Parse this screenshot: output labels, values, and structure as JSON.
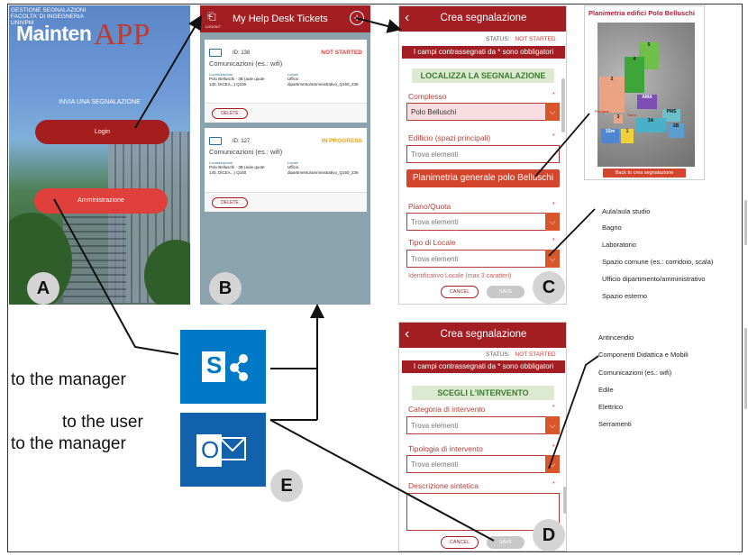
{
  "panel_a": {
    "header_lines": [
      "GESTIONE SEGNALAZIONI",
      "FACOLTA' DI INGEGNERIA",
      "UNIVPM"
    ],
    "logo_part1": "Mainten",
    "logo_part2": "APP",
    "subtitle": "INVIA UNA SEGNALAZIONE",
    "login_label": "Login",
    "admin_label": "Amministrazione",
    "badge": "A"
  },
  "panel_b": {
    "icon_caption": "LOGOUT",
    "title": "My Help Desk Tickets",
    "badge": "B",
    "tickets": [
      {
        "id": "ID: 138",
        "status": "NOT STARTED",
        "status_color": "#e0403c",
        "category": "Comunicazioni (es.: wifi)",
        "loc_label": "Localizzazione",
        "loc_value": "Polo Belluschi - 3B (aule quote 140, DICEA...) Q150",
        "locale_label": "Locale",
        "locale_value": "Ufficio dipartimento/amministrativo_Q150_239",
        "delete_label": "DELETE"
      },
      {
        "id": "ID: 127",
        "status": "IN PROGRESS",
        "status_color": "#e8a317",
        "category": "Comunicazioni (es.: wifi)",
        "loc_label": "Localizzazione",
        "loc_value": "Polo Belluschi - 3B (aule quote 140, DICEA...) Q150",
        "locale_label": "Locale",
        "locale_value": "Ufficio dipartimento/amministrativo_Q150_239",
        "delete_label": "DELETE"
      }
    ]
  },
  "panel_c": {
    "title": "Crea segnalazione",
    "status_label": "STATUS:",
    "status_value": "NOT STARTED",
    "required_note": "I campi contrassegnati da * sono obbligatori",
    "section": "LOCALIZZA LA SEGNALAZIONE",
    "field1_label": "Complesso",
    "field1_value": "Polo Belluschi",
    "field2_label": "Edificio (spazi principali)",
    "field2_value": "Trova elementi",
    "map_button": "Planimetria generale polo Belluschi",
    "field3_label": "Piano/Quota",
    "field3_value": "Trova elementi",
    "field4_label": "Tipo di Locale",
    "field4_value": "Trova elementi",
    "field5_label": "Identificativo Locale (max 3 caratteri)",
    "cancel_label": "CANCEL",
    "save_label": "SAVE",
    "star": "*",
    "badge": "C"
  },
  "map": {
    "title": "Planimetria edifici Polo Belluschi",
    "back_label": "Back to crea segnalazione",
    "labels": [
      "1",
      "2",
      "3",
      "3A",
      "3B",
      "4",
      "5",
      "PMS",
      "AMA",
      "1Sm",
      "Fontana",
      "Torre"
    ]
  },
  "list_locale": {
    "options": [
      "Aula/aula studio",
      "Bagno",
      "Laboratorio",
      "Spazio comune (es.: corridoio, scala)",
      "Ufficio dipartimento/amministrativo",
      "Spazio esterno"
    ]
  },
  "panel_d": {
    "title": "Crea segnalazione",
    "status_label": "STATUS:",
    "status_value": "NOT STARTED",
    "required_note": "I campi contrassegnati da * sono obbligatori",
    "section": "SCEGLI L'INTERVENTO",
    "field1_label": "Categoria di intervento",
    "field1_value": "Trova elementi",
    "field2_label": "Tipologia di intervento",
    "field2_value": "Trova elementi",
    "field3_label": "Descrizione sintetica",
    "cancel_label": "CANCEL",
    "save_label": "SAVE",
    "star": "*",
    "badge": "D"
  },
  "list_intervento": {
    "options": [
      "Antincendio",
      "Componenti Didattica e Mobili",
      "Comunicazioni (es.: wifi)",
      "Edile",
      "Elettrico",
      "Serramenti"
    ]
  },
  "panel_e": {
    "caption_manager": "to the manager",
    "caption_user": "to the user",
    "caption_manager2": "to the manager",
    "sharepoint_letter": "S",
    "outlook_letter": "O",
    "badge": "E"
  }
}
